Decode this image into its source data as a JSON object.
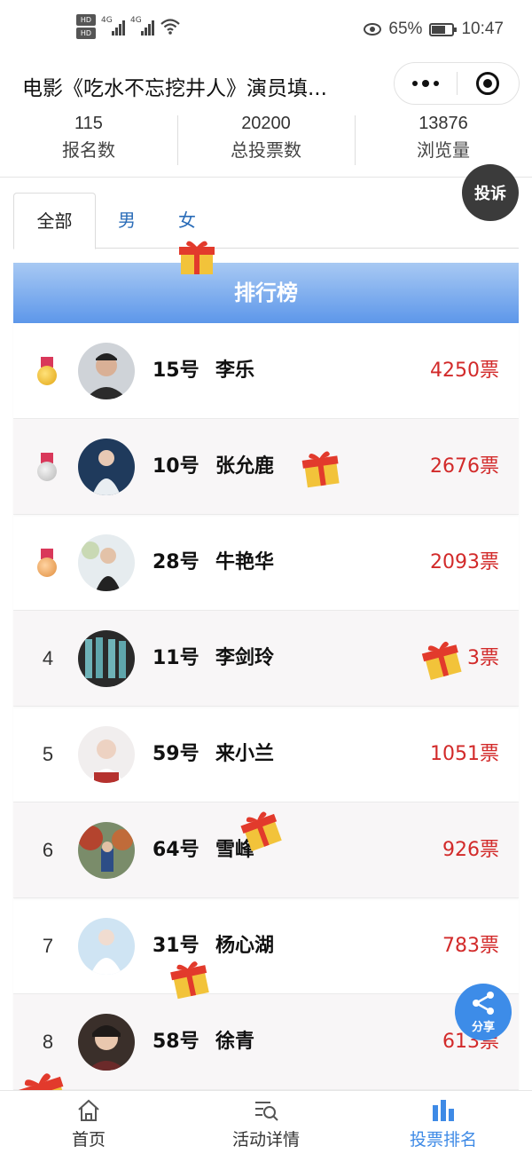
{
  "status_bar": {
    "hd1": "HD",
    "hd2": "HD",
    "net1": "4G",
    "net2": "4G",
    "battery": "65%",
    "time": "10:47"
  },
  "title_bar": {
    "title": "电影《吃水不忘挖井人》演员填..."
  },
  "stats": [
    {
      "value": "115",
      "label": "报名数"
    },
    {
      "value": "20200",
      "label": "总投票数"
    },
    {
      "value": "13876",
      "label": "浏览量"
    }
  ],
  "complain_label": "投诉",
  "tabs": [
    {
      "label": "全部",
      "active": true
    },
    {
      "label": "男",
      "active": false
    },
    {
      "label": "女",
      "active": false
    }
  ],
  "rank_header": "排行榜",
  "rankings": [
    {
      "rank": "1",
      "medal": "gold",
      "number": "15号",
      "name": "李乐",
      "votes": "4250票"
    },
    {
      "rank": "2",
      "medal": "silver",
      "number": "10号",
      "name": "张允鹿",
      "votes": "2676票"
    },
    {
      "rank": "3",
      "medal": "bronze",
      "number": "28号",
      "name": "牛艳华",
      "votes": "2093票"
    },
    {
      "rank": "4",
      "number": "11号",
      "name": "李剑玲",
      "votes": "3票"
    },
    {
      "rank": "5",
      "number": "59号",
      "name": "来小兰",
      "votes": "1051票"
    },
    {
      "rank": "6",
      "number": "64号",
      "name": "雪峰",
      "votes": "926票"
    },
    {
      "rank": "7",
      "number": "31号",
      "name": "杨心湖",
      "votes": "783票"
    },
    {
      "rank": "8",
      "number": "58号",
      "name": "徐青",
      "votes": "613票"
    }
  ],
  "share_label": "分享",
  "bottom_nav": [
    {
      "label": "首页",
      "icon": "home-icon",
      "active": false
    },
    {
      "label": "活动详情",
      "icon": "search-list-icon",
      "active": false
    },
    {
      "label": "投票排名",
      "icon": "bar-chart-icon",
      "active": true
    }
  ],
  "colors": {
    "accent": "#3e8ae6",
    "vote_red": "#d22a2a",
    "header_gradient_top": "#a8c9f3",
    "header_gradient_bottom": "#5d97ea"
  }
}
